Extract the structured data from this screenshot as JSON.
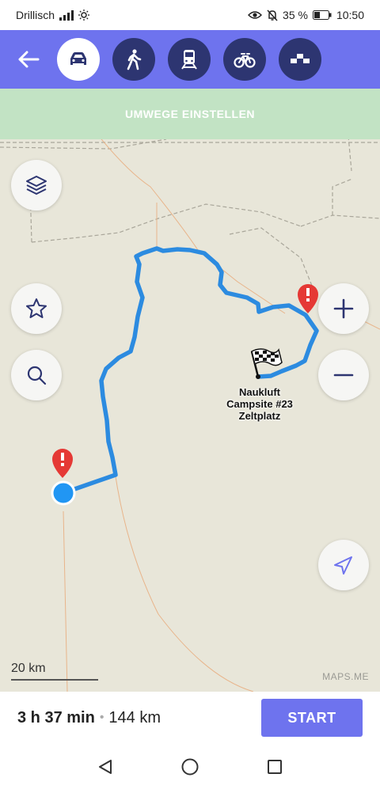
{
  "status_bar": {
    "carrier": "Drillisch",
    "battery": "35 %",
    "time": "10:50"
  },
  "toolbar": {
    "back_icon": "arrow-left-icon",
    "modes": [
      {
        "name": "car",
        "icon": "car-icon",
        "active": true
      },
      {
        "name": "walk",
        "icon": "pedestrian-icon",
        "active": false
      },
      {
        "name": "transit",
        "icon": "train-icon",
        "active": false
      },
      {
        "name": "bicycle",
        "icon": "bicycle-icon",
        "active": false
      },
      {
        "name": "taxi",
        "icon": "taxi-icon",
        "active": false
      }
    ],
    "colors": {
      "bar": "#6e73ee",
      "mode_bg": "#2d3571"
    }
  },
  "banner": {
    "text": "UMWEGE EINSTELLEN"
  },
  "map": {
    "destination": {
      "line1": "Naukluft",
      "line2": "Campsite #23",
      "line3": "Zeltplatz"
    },
    "scale": "20 km",
    "attribution": "MAPS.ME",
    "route_color": "#1e88e5",
    "controls": [
      "layers-icon",
      "star-icon",
      "search-icon",
      "zoom-in-icon",
      "zoom-out-icon",
      "my-location-icon"
    ]
  },
  "route": {
    "duration": "3 h 37 min",
    "separator": "•",
    "distance": "144 km",
    "start_label": "START"
  },
  "nav_bar": {
    "icons": [
      "back-triangle-icon",
      "home-circle-icon",
      "recents-square-icon"
    ]
  }
}
